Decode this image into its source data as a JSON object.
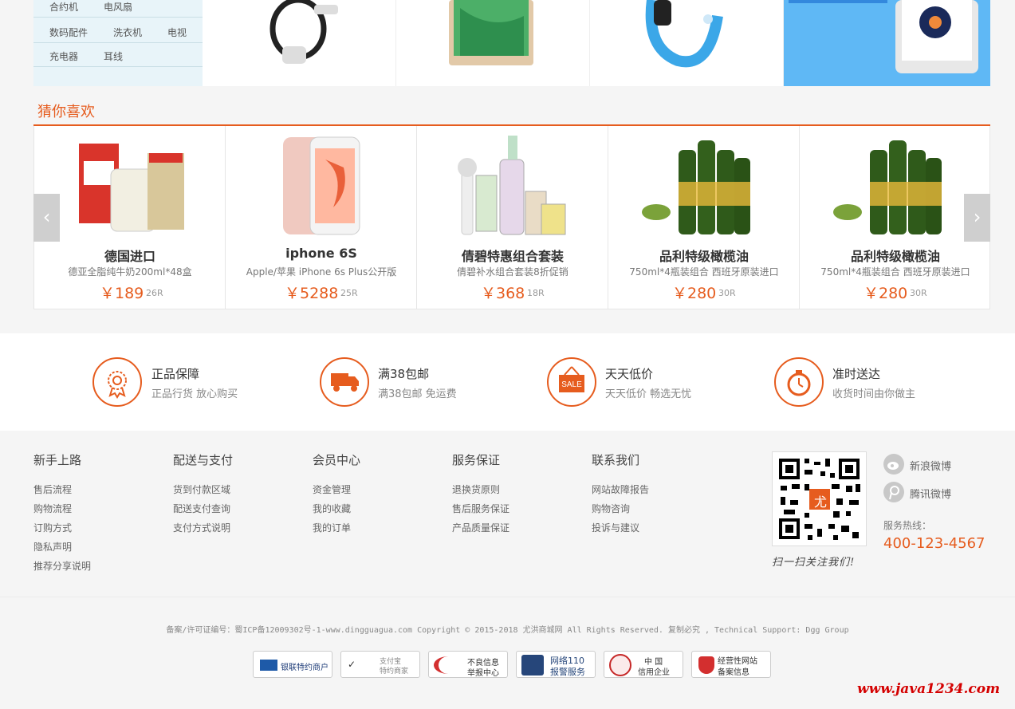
{
  "categories": {
    "rows": [
      [
        "合约机",
        "电风扇"
      ],
      [
        "数码配件",
        "洗衣机",
        "电视"
      ],
      [
        "充电器",
        "耳线"
      ]
    ]
  },
  "guess": {
    "title": "猜你喜欢",
    "items": [
      {
        "name": "德国进口",
        "desc": "德亚全脂纯牛奶200ml*48盒",
        "price": "￥189",
        "comment": "26R"
      },
      {
        "name": "iphone 6S",
        "desc": "Apple/苹果 iPhone 6s Plus公开版",
        "price": "￥5288",
        "comment": "25R"
      },
      {
        "name": "倩碧特惠组合套装",
        "desc": "倩碧补水组合套装8折促销",
        "price": "￥368",
        "comment": "18R"
      },
      {
        "name": "品利特级橄榄油",
        "desc": "750ml*4瓶装组合 西班牙原装进口",
        "price": "￥280",
        "comment": "30R"
      },
      {
        "name": "品利特级橄榄油",
        "desc": "750ml*4瓶装组合 西班牙原装进口",
        "price": "￥280",
        "comment": "30R"
      }
    ]
  },
  "services": [
    {
      "title": "正品保障",
      "sub": "正品行货 放心购买",
      "icon": "medal-icon"
    },
    {
      "title": "满38包邮",
      "sub": "满38包邮 免运费",
      "icon": "truck-icon"
    },
    {
      "title": "天天低价",
      "sub": "天天低价 畅选无忧",
      "icon": "sale-tag-icon",
      "tag": "SALE"
    },
    {
      "title": "准时送达",
      "sub": "收货时间由你做主",
      "icon": "stopwatch-icon"
    }
  ],
  "footer": {
    "columns": [
      {
        "title": "新手上路",
        "links": [
          "售后流程",
          "购物流程",
          "订购方式",
          "隐私声明",
          "推荐分享说明"
        ]
      },
      {
        "title": "配送与支付",
        "links": [
          "货到付款区域",
          "配送支付查询",
          "支付方式说明"
        ]
      },
      {
        "title": "会员中心",
        "links": [
          "资金管理",
          "我的收藏",
          "我的订单"
        ]
      },
      {
        "title": "服务保证",
        "links": [
          "退换货原则",
          "售后服务保证",
          "产品质量保证"
        ]
      },
      {
        "title": "联系我们",
        "links": [
          "网站故障报告",
          "购物咨询",
          "投诉与建议"
        ]
      }
    ],
    "qr_center": "尤",
    "qr_caption": "扫一扫关注我们!",
    "weibo_sina": "新浪微博",
    "weibo_tencent": "腾讯微博",
    "hotline_label": "服务热线：",
    "hotline": "400-123-4567"
  },
  "copyright": "备案/许可证编号：蜀ICP备12009302号-1-www.dingguagua.com Copyright © 2015-2018 尤洪商城网 All Rights Reserved. 复制必究 , Technical Support: Dgg Group",
  "badges": [
    {
      "line1": "银联特约商户",
      "line2": ""
    },
    {
      "line1": "支付宝",
      "line2": "特约商家"
    },
    {
      "line1": "不良信息",
      "line2": "举报中心"
    },
    {
      "line1": "网络110",
      "line2": "报警服务"
    },
    {
      "line1": "中 国",
      "line2": "信用企业"
    },
    {
      "line1": "经营性网站",
      "line2": "备案信息"
    }
  ],
  "watermark": "www.java1234.com",
  "colors": {
    "accent": "#e65c1e",
    "blue": "#5fb8f5"
  }
}
